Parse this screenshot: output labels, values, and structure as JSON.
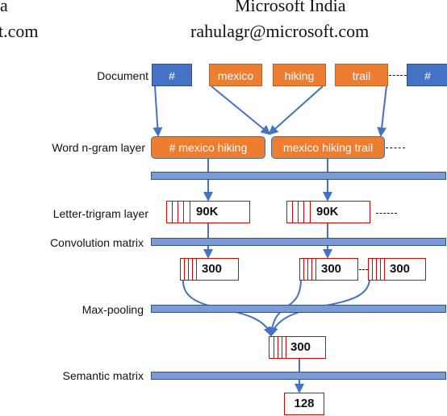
{
  "header": {
    "left_line1": "a",
    "left_line2": "t.com",
    "right_line1": "Microsoft India",
    "right_line2": "rahulagr@microsoft.com"
  },
  "layers": {
    "document": "Document",
    "word_ngram": "Word n-gram layer",
    "letter_trigram": "Letter-trigram layer",
    "convolution": "Convolution matrix",
    "max_pooling": "Max-pooling",
    "semantic": "Semantic matrix"
  },
  "document_tokens": [
    {
      "text": "#",
      "kind": "boundary"
    },
    {
      "text": "mexico",
      "kind": "word"
    },
    {
      "text": "hiking",
      "kind": "word"
    },
    {
      "text": "trail",
      "kind": "word"
    },
    {
      "text": "#",
      "kind": "boundary"
    }
  ],
  "ngrams": [
    "# mexico hiking",
    "mexico hiking trail"
  ],
  "trigram_vectors": [
    "90K",
    "90K"
  ],
  "conv_vectors": [
    "300",
    "300",
    "300"
  ],
  "pooled_vector": "300",
  "semantic_vector": "128",
  "colors": {
    "boundary_token": "#4472C4",
    "word_token": "#ED7D31",
    "matrix_bar": "#7A9BD4",
    "vector_border": "#E00000",
    "arrow": "#4472C4"
  }
}
